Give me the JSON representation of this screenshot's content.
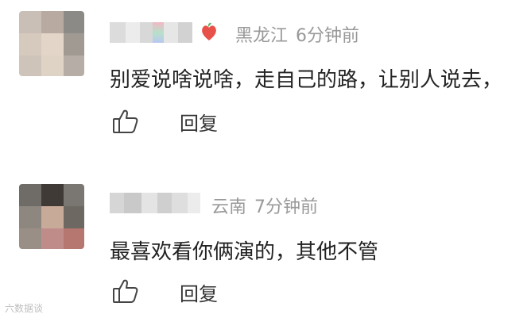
{
  "comments": [
    {
      "location": "黑龙江",
      "time": "6分钟前",
      "text": "别爱说啥说啥，走自己的路，让别人说去，",
      "reply_label": "回复",
      "like_icon": "thumbs-up-icon",
      "badge_icon": "heart-badge-icon"
    },
    {
      "location": "云南",
      "time": "7分钟前",
      "text": "最喜欢看你俩演的，其他不管",
      "reply_label": "回复",
      "like_icon": "thumbs-up-icon"
    }
  ],
  "colors": {
    "meta_text": "#999999",
    "body_text": "#222222",
    "reply_text": "#333333",
    "badge_red": "#e8504a",
    "badge_green": "#5bb36a"
  },
  "watermark": {
    "text": "六数据谈"
  }
}
